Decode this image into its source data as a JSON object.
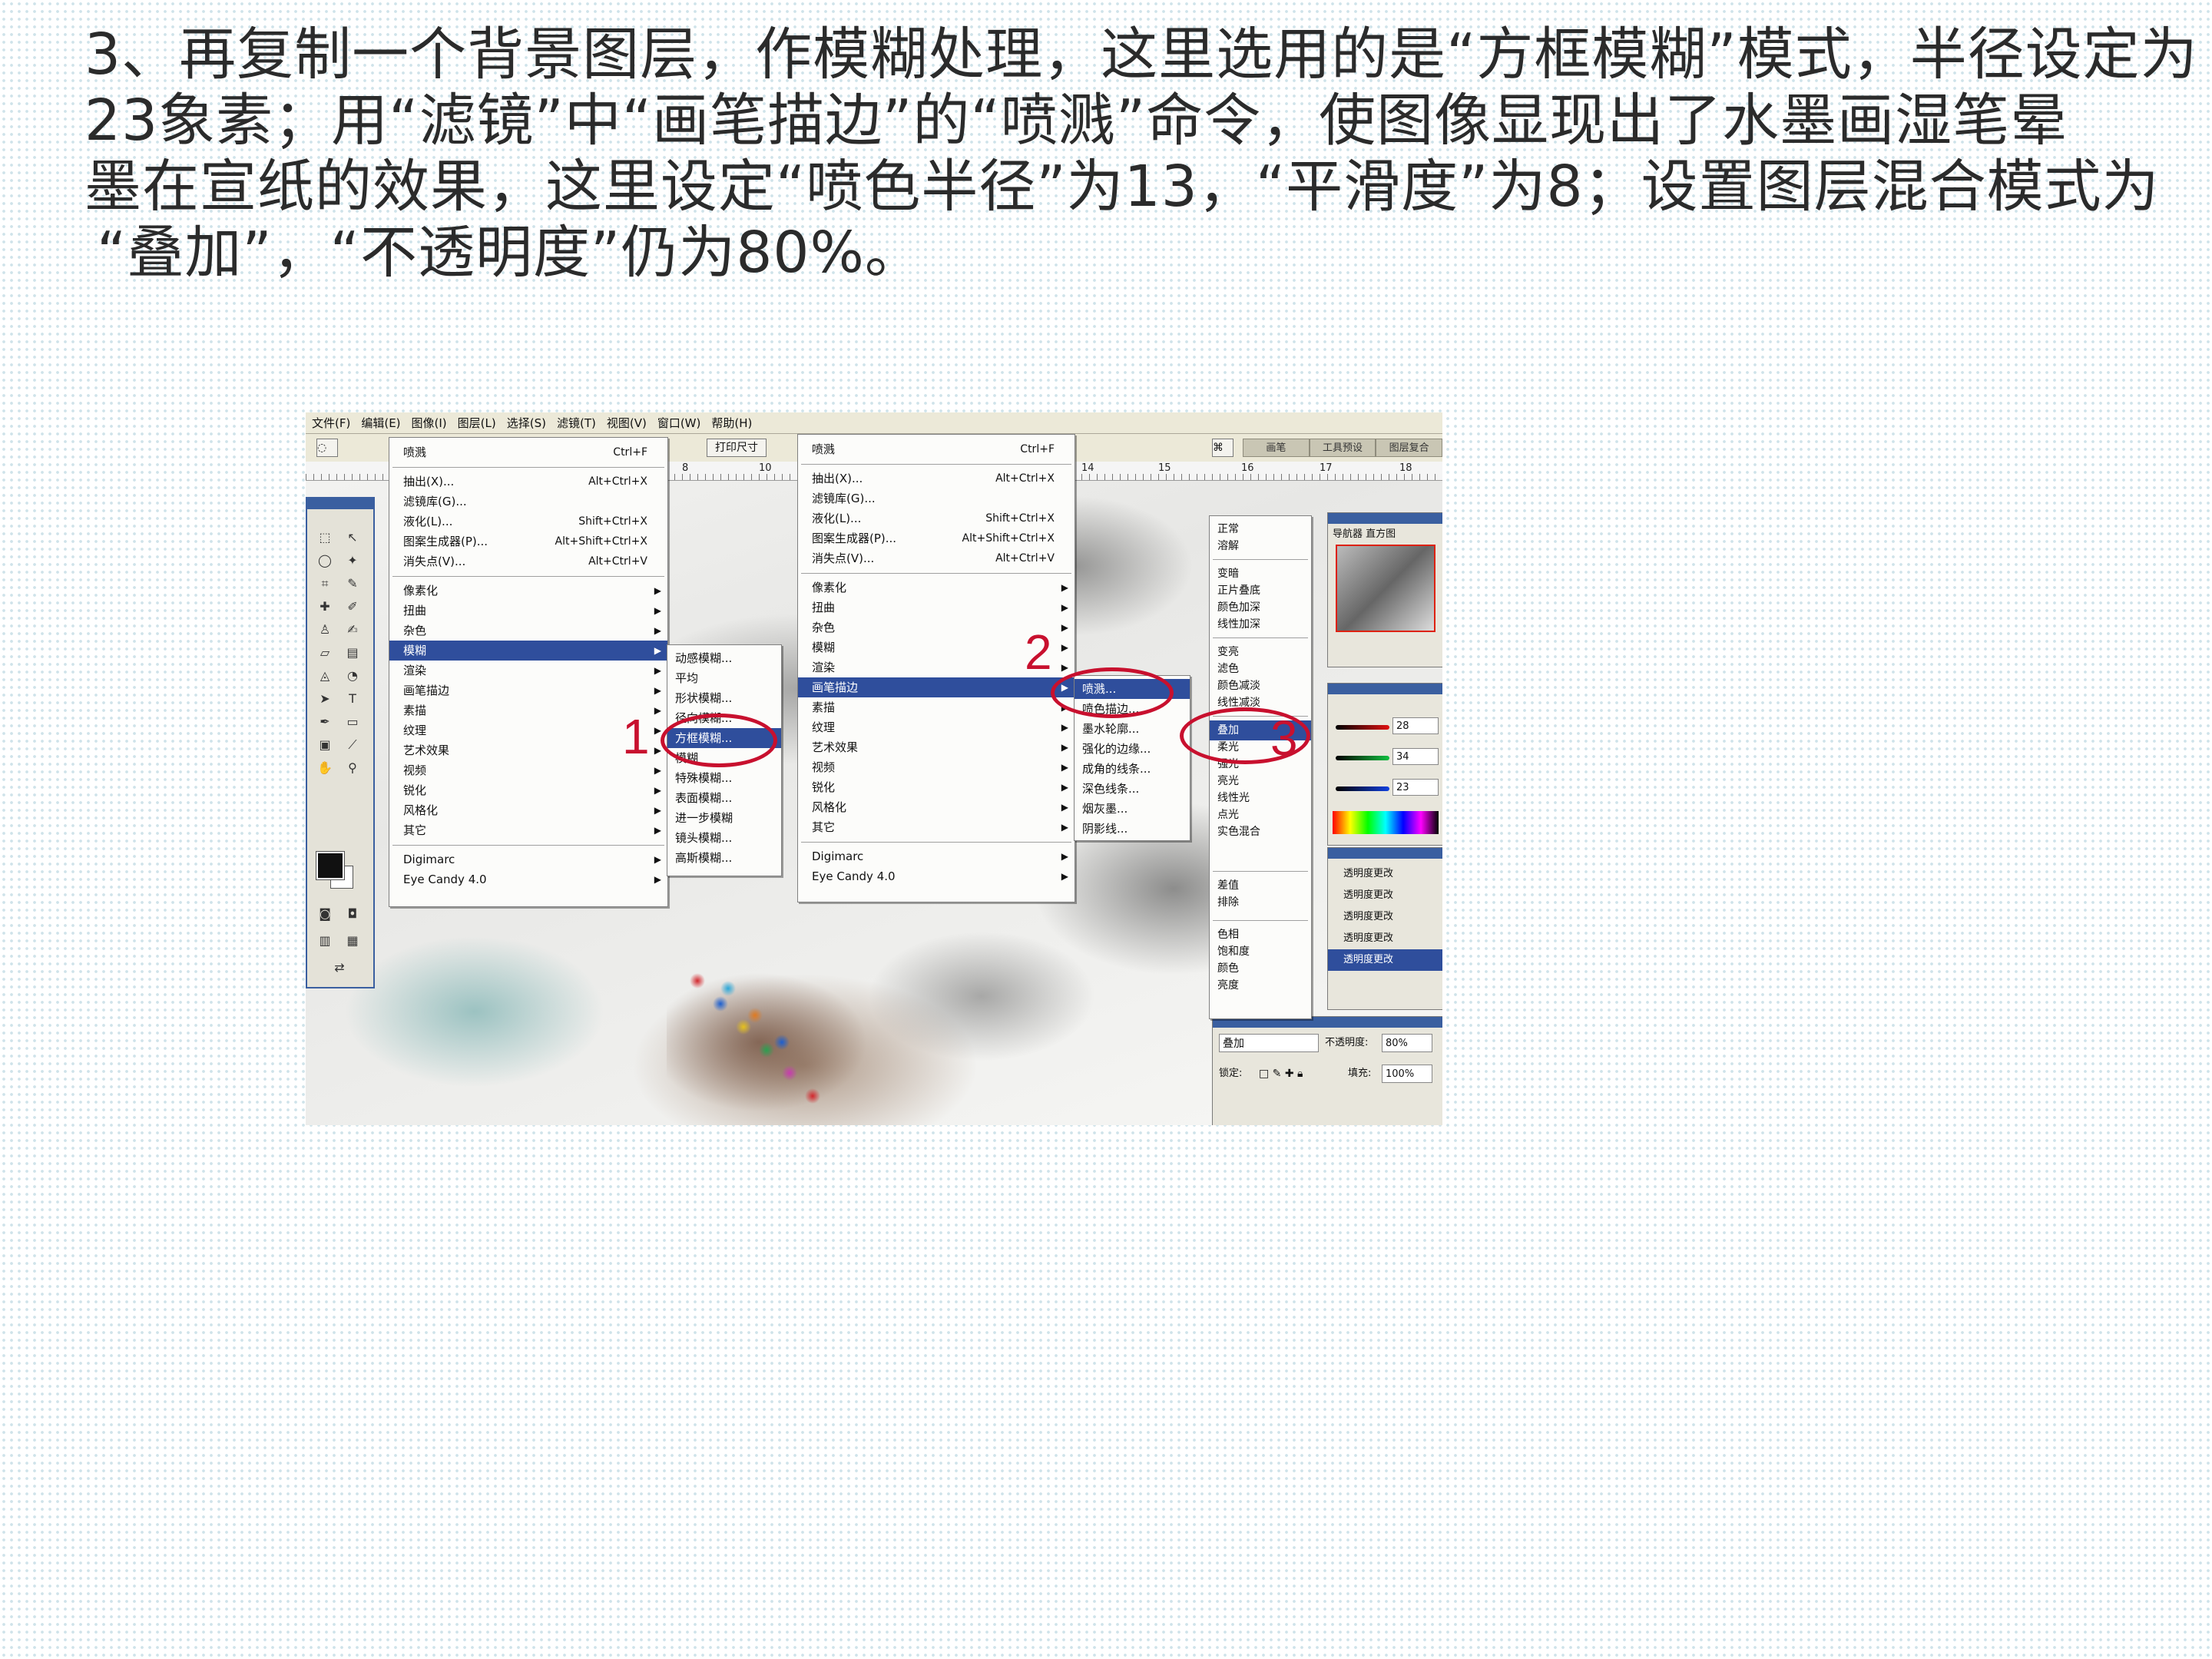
{
  "heading": {
    "line1": "3、再复制一个背景图层，作模糊处理，这里选用的是“方框模糊”模式，半径设定为",
    "line2": "23象素；用“滤镜”中“画笔描边”的“喷溅”命令，使图像显现出了水墨画湿笔晕",
    "line3": "墨在宣纸的效果，这里设定“喷色半径”为13，“平滑度”为8；设置图层混合模式为",
    "line4": "“叠加”，“不透明度”仍为80%。"
  },
  "screenshot": {
    "menubar": [
      "文件(F)",
      "编辑(E)",
      "图像(I)",
      "图层(L)",
      "选择(S)",
      "滤镜(T)",
      "视图(V)",
      "窗口(W)",
      "帮助(H)"
    ],
    "options": {
      "button1": "",
      "print_size": "打印尺寸"
    },
    "palette_tabs": [
      "画笔",
      "工具预设",
      "图层复合"
    ],
    "ruler_ticks": [
      "8",
      "10",
      "14",
      "15",
      "16",
      "17",
      "18"
    ],
    "filter_menu_1": {
      "last_filter": "喷溅",
      "last_filter_shortcut": "Ctrl+F",
      "top_items": [
        {
          "label": "抽出(X)...",
          "shortcut": "Alt+Ctrl+X"
        },
        {
          "label": "滤镜库(G)...",
          "shortcut": ""
        },
        {
          "label": "液化(L)...",
          "shortcut": "Shift+Ctrl+X"
        },
        {
          "label": "图案生成器(P)...",
          "shortcut": "Alt+Shift+Ctrl+X"
        },
        {
          "label": "消失点(V)...",
          "shortcut": "Alt+Ctrl+V"
        }
      ],
      "categories": [
        "像素化",
        "扭曲",
        "杂色",
        "模糊",
        "渲染",
        "画笔描边",
        "素描",
        "纹理",
        "艺术效果",
        "视频",
        "锐化",
        "风格化",
        "其它"
      ],
      "plugins": [
        "Digimarc",
        "Eye Candy 4.0"
      ]
    },
    "blur_submenu": [
      "动感模糊...",
      "平均",
      "形状模糊...",
      "径向模糊...",
      "方框模糊...",
      "模糊",
      "特殊模糊...",
      "表面模糊...",
      "进一步模糊",
      "镜头模糊...",
      "高斯模糊..."
    ],
    "filter_menu_2": {
      "last_filter": "喷溅",
      "last_filter_shortcut": "Ctrl+F",
      "top_items": [
        {
          "label": "抽出(X)...",
          "shortcut": "Alt+Ctrl+X"
        },
        {
          "label": "滤镜库(G)...",
          "shortcut": ""
        },
        {
          "label": "液化(L)...",
          "shortcut": "Shift+Ctrl+X"
        },
        {
          "label": "图案生成器(P)...",
          "shortcut": "Alt+Shift+Ctrl+X"
        },
        {
          "label": "消失点(V)...",
          "shortcut": "Alt+Ctrl+V"
        }
      ],
      "categories": [
        "像素化",
        "扭曲",
        "杂色",
        "模糊",
        "渲染",
        "画笔描边",
        "素描",
        "纹理",
        "艺术效果",
        "视频",
        "锐化",
        "风格化",
        "其它"
      ],
      "plugins": [
        "Digimarc",
        "Eye Candy 4.0"
      ]
    },
    "brush_submenu": [
      "喷溅...",
      "喷色描边...",
      "墨水轮廓...",
      "强化的边缘...",
      "成角的线条...",
      "深色线条...",
      "烟灰墨...",
      "阴影线..."
    ],
    "blend_modes": {
      "group1": [
        "正常",
        "溶解"
      ],
      "group2": [
        "变暗",
        "正片叠底",
        "颜色加深",
        "线性加深"
      ],
      "group3": [
        "变亮",
        "滤色",
        "颜色减淡",
        "线性减淡"
      ],
      "group4": [
        "叠加",
        "柔光",
        "强光",
        "亮光",
        "线性光",
        "点光",
        "实色混合"
      ],
      "group5": [
        "差值",
        "排除"
      ],
      "group6": [
        "色相",
        "饱和度",
        "颜色",
        "亮度"
      ]
    },
    "navigator_title": "导航器  直方图",
    "color_values": [
      "28",
      "34",
      "23"
    ],
    "history_items": [
      "透明度更改",
      "透明度更改",
      "透明度更改",
      "透明度更改",
      "透明度更改"
    ],
    "layers": {
      "mode": "叠加",
      "opacity_label": "不透明度:",
      "opacity": "80%",
      "lock_label": "锁定:",
      "fill_label": "填充:",
      "fill": "100%"
    },
    "callouts": [
      "1",
      "2",
      "3"
    ],
    "colors": {
      "highlight": "#2f4e9c",
      "callout": "#c8102e",
      "title_bar": "#3a5fa0"
    }
  }
}
